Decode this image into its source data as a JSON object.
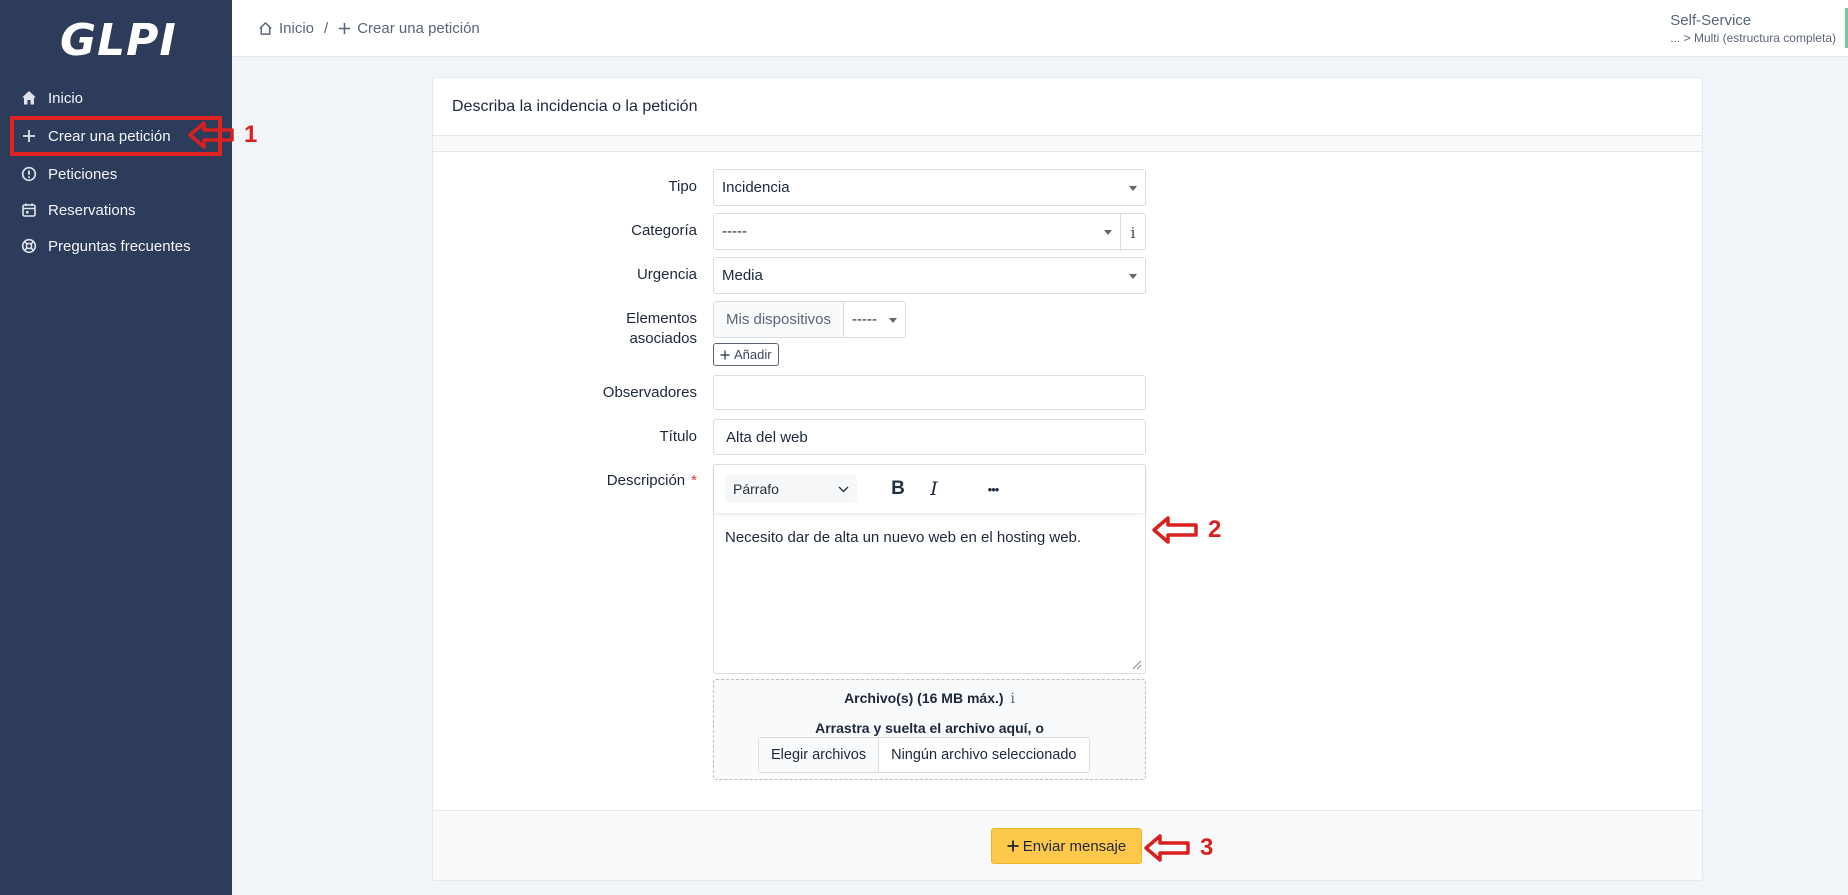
{
  "app": {
    "logo_text": "GLPI"
  },
  "sidebar": {
    "items": [
      {
        "label": "Inicio",
        "icon": "home-icon"
      },
      {
        "label": "Crear una petición",
        "icon": "plus-icon"
      },
      {
        "label": "Peticiones",
        "icon": "alert-circle-icon"
      },
      {
        "label": "Reservations",
        "icon": "calendar-icon"
      },
      {
        "label": "Preguntas frecuentes",
        "icon": "lifebuoy-icon"
      }
    ]
  },
  "breadcrumb": {
    "home": "Inicio",
    "separator": "/",
    "current": "Crear una petición"
  },
  "user": {
    "profile": "Self-Service",
    "entity": "... > Multi (estructura completa)"
  },
  "form": {
    "header": "Describa la incidencia o la petición",
    "tipo": {
      "label": "Tipo",
      "value": "Incidencia"
    },
    "categoria": {
      "label": "Categoría",
      "value": "-----",
      "info": "i"
    },
    "urgencia": {
      "label": "Urgencia",
      "value": "Media"
    },
    "elementos": {
      "label_line1": "Elementos",
      "label_line2": "asociados",
      "devices_button": "Mis dispositivos",
      "devices_value": "-----",
      "add_button": "Añadir"
    },
    "observadores": {
      "label": "Observadores",
      "value": ""
    },
    "titulo": {
      "label": "Título",
      "value": "Alta del web"
    },
    "descripcion": {
      "label": "Descripción",
      "required_mark": "*",
      "format_value": "Párrafo",
      "bold_label": "B",
      "italic_label": "I",
      "more_label": "•••",
      "body": "Necesito dar de alta un nuevo web en el hosting web."
    },
    "archivos": {
      "title": "Archivo(s) (16 MB máx.)",
      "info": "i",
      "drag_text": "Arrastra y suelta el archivo aquí, o",
      "choose_button": "Elegir archivos",
      "status": "Ningún archivo seleccionado"
    },
    "submit": {
      "label": "Enviar mensaje"
    }
  },
  "annotations": {
    "one": "1",
    "two": "2",
    "three": "3"
  },
  "colors": {
    "sidebar_bg": "#2e3c5b",
    "submit_bg": "#fec84b",
    "annotation_red": "#d92020"
  }
}
